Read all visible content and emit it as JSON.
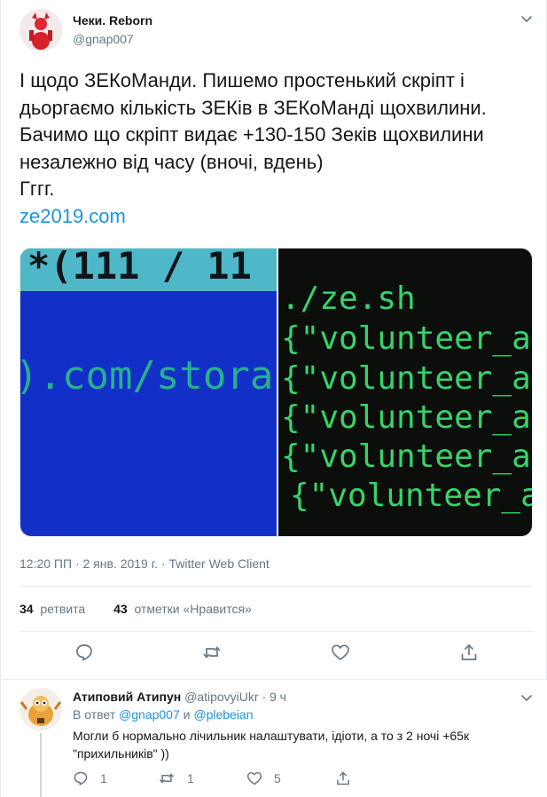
{
  "tweet": {
    "author_name": "Чеки. Reborn",
    "author_handle": "@gnap007",
    "text_lines": [
      "І щодо ЗЕКоМанди. Пишемо простенький скріпт і",
      "дьоргаємо кількість ЗЕКів в ЗЕКоМанді щохвилини.",
      "Бачимо що скріпт видає +130-150 Зеків щохвилини",
      "незалежно від часу (вночі, вдень)",
      "Гггг."
    ],
    "link_text": "ze2019.com",
    "timestamp": "12:20 ПП · 2 янв. 2019 г. · Twitter Web Client",
    "retweets_count": "34",
    "retweets_label": "ретвита",
    "likes_count": "43",
    "likes_label": "отметки «Нравится»"
  },
  "media": {
    "left_image": {
      "top_text": "*(111 / 11",
      "main_text": ").com/stora"
    },
    "right_image": {
      "lines": [
        "./ze.sh",
        "{\"volunteer_a",
        "{\"volunteer_a",
        "{\"volunteer_a",
        "{\"volunteer_a",
        "{\"volunteer_a"
      ]
    }
  },
  "reply": {
    "author_name": "Атиповий Атипун",
    "author_handle": "@atipovyiUkr",
    "time": "9 ч",
    "reply_prefix": "В ответ",
    "mention1": "@gnap007",
    "and_word": "и",
    "mention2": "@plebeian",
    "text_line1": "Могли б нормально лічильник налаштувати, ідіоти, а то з 2 ночі +65к",
    "text_line2": "\"прихильників\" ))",
    "reply_count": "1",
    "retweet_count": "1",
    "like_count": "5"
  },
  "icons": {
    "caret": "chevron-down-icon",
    "reply": "reply-icon",
    "retweet": "retweet-icon",
    "like": "heart-icon",
    "share": "share-icon"
  },
  "colors": {
    "accent": "#1b95e0",
    "secondary_text": "#657786",
    "action_icon": "#657786",
    "left_image_bg": "#1230c8",
    "left_image_text": "#27b08c",
    "right_image_bg": "#0c0e0c",
    "right_image_text": "#36d46a"
  }
}
